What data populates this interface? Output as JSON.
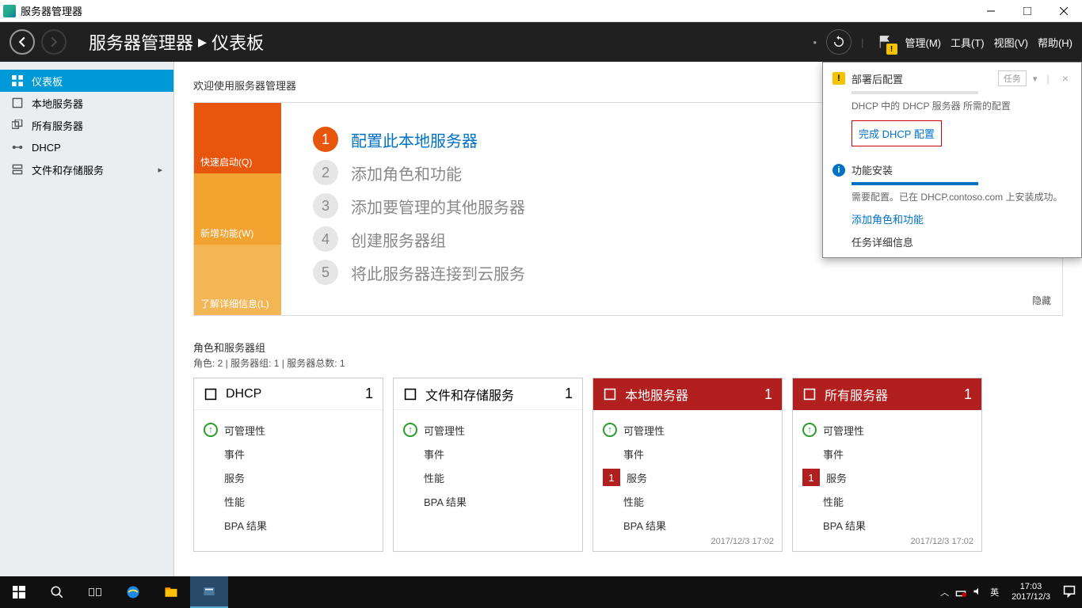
{
  "window": {
    "title": "服务器管理器"
  },
  "header": {
    "breadcrumb_root": "服务器管理器",
    "breadcrumb_page": "仪表板",
    "menus": {
      "manage": "管理(M)",
      "tools": "工具(T)",
      "view": "视图(V)",
      "help": "帮助(H)"
    }
  },
  "sidebar": {
    "items": [
      {
        "label": "仪表板",
        "icon": "dashboard"
      },
      {
        "label": "本地服务器",
        "icon": "server"
      },
      {
        "label": "所有服务器",
        "icon": "servers"
      },
      {
        "label": "DHCP",
        "icon": "dhcp"
      },
      {
        "label": "文件和存储服务",
        "icon": "storage"
      }
    ]
  },
  "welcome": {
    "heading": "欢迎使用服务器管理器",
    "tabs": {
      "t1": "快速启动(Q)",
      "t2": "新增功能(W)",
      "t3": "了解详细信息(L)"
    },
    "steps": [
      {
        "num": "1",
        "label": "配置此本地服务器"
      },
      {
        "num": "2",
        "label": "添加角色和功能"
      },
      {
        "num": "3",
        "label": "添加要管理的其他服务器"
      },
      {
        "num": "4",
        "label": "创建服务器组"
      },
      {
        "num": "5",
        "label": "将此服务器连接到云服务"
      }
    ],
    "hide": "隐藏"
  },
  "groups": {
    "title": "角色和服务器组",
    "subtitle": "角色: 2 | 服务器组: 1 | 服务器总数: 1",
    "row_labels": {
      "manage": "可管理性",
      "events": "事件",
      "services": "服务",
      "perf": "性能",
      "bpa": "BPA 结果"
    },
    "tiles": [
      {
        "title": "DHCP",
        "count": "1",
        "red": false,
        "rows": [
          "manage_ok",
          "events",
          "services",
          "perf",
          "bpa"
        ],
        "foot": ""
      },
      {
        "title": "文件和存储服务",
        "count": "1",
        "red": false,
        "rows": [
          "manage_ok",
          "events",
          "perf",
          "bpa"
        ],
        "foot": ""
      },
      {
        "title": "本地服务器",
        "count": "1",
        "red": true,
        "rows": [
          "manage_ok",
          "events",
          "services_err",
          "perf",
          "bpa"
        ],
        "foot": "2017/12/3 17:02"
      },
      {
        "title": "所有服务器",
        "count": "1",
        "red": true,
        "rows": [
          "manage_ok",
          "events",
          "services_err",
          "perf",
          "bpa"
        ],
        "foot": "2017/12/3 17:02"
      }
    ],
    "err_badge": "1"
  },
  "notifications": {
    "items": [
      {
        "icon": "warn",
        "title": "部署后配置",
        "task_label": "任务",
        "desc": "DHCP 中的 DHCP 服务器 所需的配置",
        "link": "完成 DHCP 配置",
        "link_boxed": true,
        "progress": "empty"
      },
      {
        "icon": "info",
        "title": "功能安装",
        "desc": "需要配置。已在 DHCP.contoso.com 上安装成功。",
        "link": "添加角色和功能",
        "plain": "任务详细信息",
        "progress": "full"
      }
    ]
  },
  "taskbar": {
    "ime": "英",
    "time": "17:03",
    "date": "2017/12/3"
  }
}
